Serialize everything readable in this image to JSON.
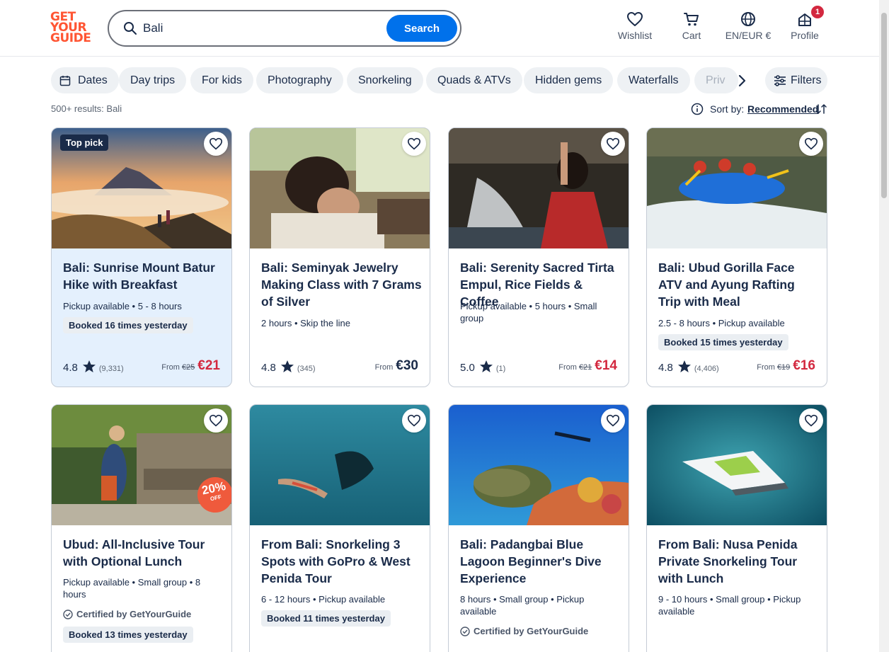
{
  "brand": {
    "logo_line1": "GET",
    "logo_line2": "YOUR",
    "logo_line3": "GUIDE",
    "accent": "#ff5533"
  },
  "search": {
    "value": "Bali",
    "button_label": "Search"
  },
  "nav": {
    "wishlist": "Wishlist",
    "cart": "Cart",
    "language": "EN/EUR €",
    "profile": "Profile",
    "profile_badge": "1"
  },
  "chips": [
    "Dates",
    "Day trips",
    "For kids",
    "Photography",
    "Snorkeling",
    "Quads & ATVs",
    "Hidden gems",
    "Waterfalls",
    "Priv"
  ],
  "filters_label": "Filters",
  "results": "500+ results: Bali",
  "sort": {
    "label": "Sort by:",
    "value": "Recommended"
  },
  "cards": [
    {
      "badge": "Top pick",
      "title": "Bali: Sunrise Mount Batur Hike with Breakfast",
      "meta": "Pickup available • 5 - 8 hours",
      "booked": "Booked 16 times yesterday",
      "rating": "4.8",
      "reviews": "(9,331)",
      "from": "From",
      "old_price": "€25",
      "price": "€21"
    },
    {
      "title": "Bali: Seminyak Jewelry Making Class with 7 Grams of Silver",
      "meta": "2 hours • Skip the line",
      "rating": "4.8",
      "reviews": "(345)",
      "from": "From",
      "price": "€30"
    },
    {
      "title": "Bali: Serenity Sacred Tirta Empul, Rice Fields & Coffee",
      "meta": "Pickup available • 5 hours • Small group",
      "rating": "5.0",
      "reviews": "(1)",
      "from": "From",
      "old_price": "€21",
      "price": "€14"
    },
    {
      "title": "Bali: Ubud Gorilla Face ATV and Ayung Rafting Trip with Meal",
      "meta": "2.5 - 8 hours • Pickup available",
      "booked": "Booked 15 times yesterday",
      "rating": "4.8",
      "reviews": "(4,406)",
      "from": "From",
      "old_price": "€19",
      "price": "€16"
    },
    {
      "discount": "20%",
      "discount_sub": "OFF",
      "title": "Ubud: All-Inclusive Tour with Optional Lunch",
      "meta": "Pickup available • Small group • 8 hours",
      "certified": "Certified by GetYourGuide",
      "booked": "Booked 13 times yesterday"
    },
    {
      "title": "From Bali: Snorkeling 3 Spots with GoPro & West Penida Tour",
      "meta": "6 - 12 hours • Pickup available",
      "booked": "Booked 11 times yesterday"
    },
    {
      "title": "Bali: Padangbai Blue Lagoon Beginner's Dive Experience",
      "meta": "8 hours • Small group • Pickup available",
      "certified": "Certified by GetYourGuide"
    },
    {
      "title": "From Bali: Nusa Penida Private Snorkeling Tour with Lunch",
      "meta": "9 - 10 hours • Small group • Pickup available"
    }
  ]
}
